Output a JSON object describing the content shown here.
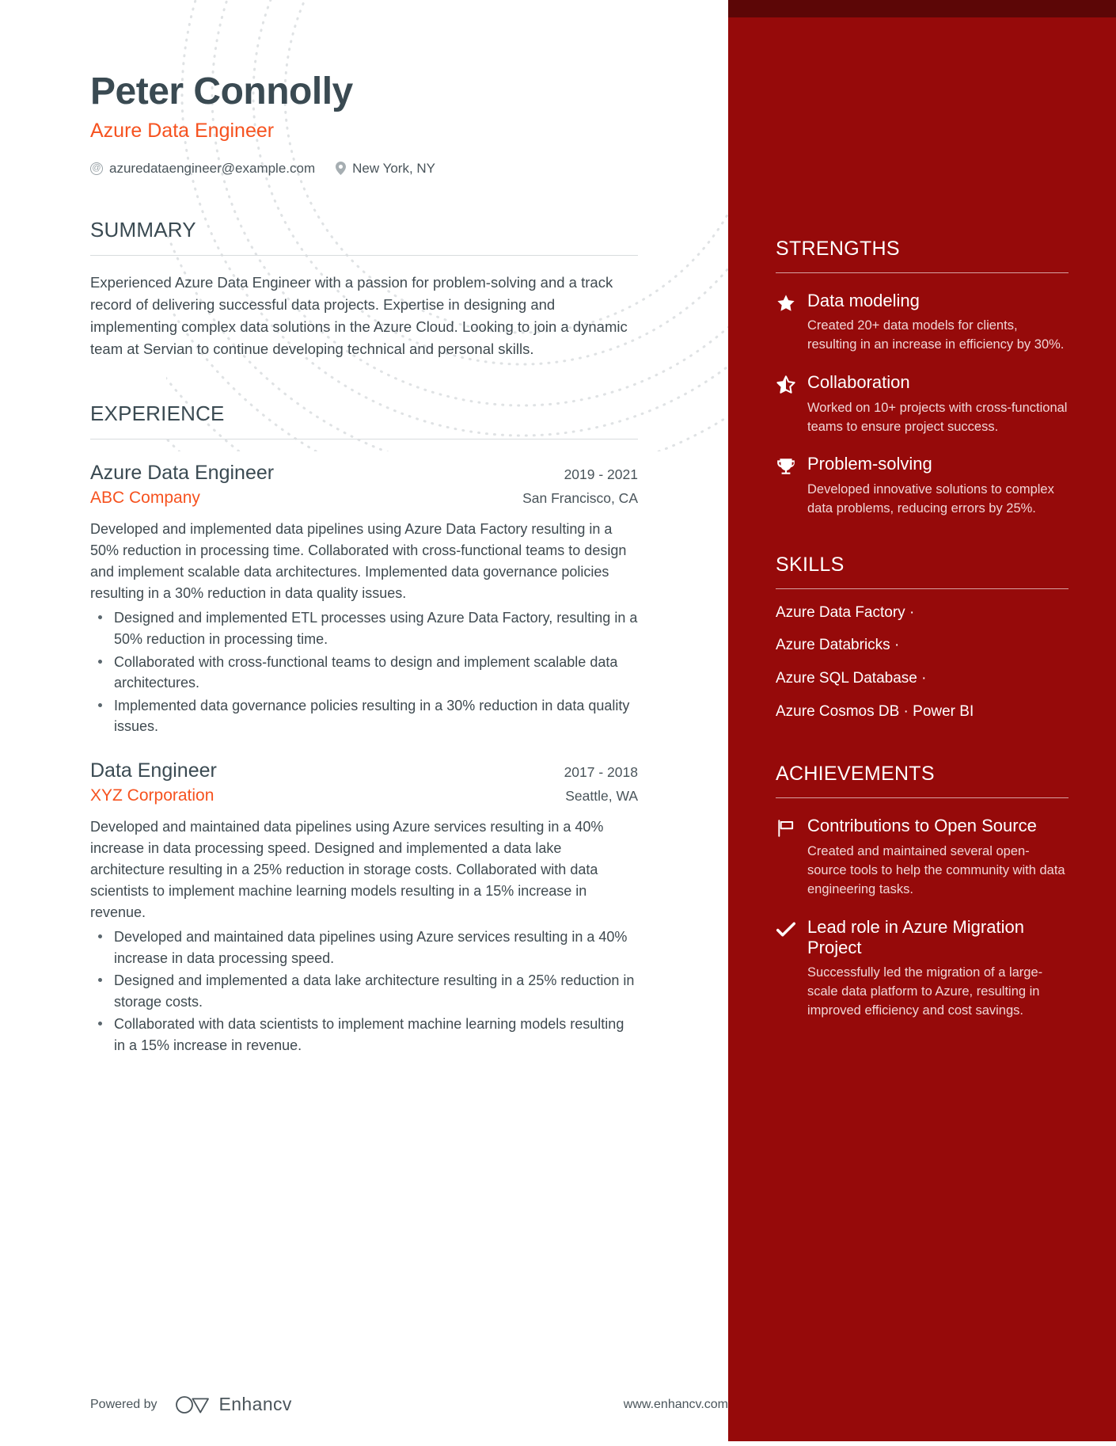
{
  "header": {
    "name": "Peter Connolly",
    "role": "Azure Data Engineer",
    "email": "azuredataengineer@example.com",
    "location": "New York, NY"
  },
  "colors": {
    "sidebar_red": "#960A0A",
    "sidebar_top_strip": "#5C0606",
    "accent_orange": "#F6521F",
    "heading_slate": "#3A4A52"
  },
  "summary": {
    "title": "SUMMARY",
    "text": "Experienced Azure Data Engineer with a passion for problem-solving and a track record of delivering successful data projects. Expertise in designing and implementing complex data solutions in the Azure Cloud. Looking to join a dynamic team at Servian to continue developing technical and personal skills."
  },
  "experience": {
    "title": "EXPERIENCE",
    "jobs": [
      {
        "title": "Azure Data Engineer",
        "dates": "2019 - 2021",
        "company": "ABC Company",
        "location": "San Francisco, CA",
        "description": "Developed and implemented data pipelines using Azure Data Factory resulting in a 50% reduction in processing time. Collaborated with cross-functional teams to design and implement scalable data architectures. Implemented data governance policies resulting in a 30% reduction in data quality issues.",
        "bullets": [
          "Designed and implemented ETL processes using Azure Data Factory, resulting in a 50% reduction in processing time.",
          "Collaborated with cross-functional teams to design and implement scalable data architectures.",
          "Implemented data governance policies resulting in a 30% reduction in data quality issues."
        ]
      },
      {
        "title": "Data Engineer",
        "dates": "2017 - 2018",
        "company": "XYZ Corporation",
        "location": "Seattle, WA",
        "description": "Developed and maintained data pipelines using Azure services resulting in a 40% increase in data processing speed. Designed and implemented a data lake architecture resulting in a 25% reduction in storage costs. Collaborated with data scientists to implement machine learning models resulting in a 15% increase in revenue.",
        "bullets": [
          "Developed and maintained data pipelines using Azure services resulting in a 40% increase in data processing speed.",
          "Designed and implemented a data lake architecture resulting in a 25% reduction in storage costs.",
          "Collaborated with data scientists to implement machine learning models resulting in a 15% increase in revenue."
        ]
      }
    ]
  },
  "strengths": {
    "title": "STRENGTHS",
    "items": [
      {
        "icon": "star-filled-icon",
        "name": "Data modeling",
        "description": "Created 20+ data models for clients, resulting in an increase in efficiency by 30%."
      },
      {
        "icon": "star-half-icon",
        "name": "Collaboration",
        "description": "Worked on 10+ projects with cross-functional teams to ensure project success."
      },
      {
        "icon": "trophy-icon",
        "name": "Problem-solving",
        "description": "Developed innovative solutions to complex data problems, reducing errors by 25%."
      }
    ]
  },
  "skills": {
    "title": "SKILLS",
    "lines": [
      "Azure Data Factory ·",
      "Azure Databricks ·",
      "Azure SQL Database ·",
      "Azure Cosmos DB · Power BI"
    ]
  },
  "achievements": {
    "title": "ACHIEVEMENTS",
    "items": [
      {
        "icon": "flag-icon",
        "name": "Contributions to Open Source",
        "description": "Created and maintained several open-source tools to help the community with data engineering tasks."
      },
      {
        "icon": "check-icon",
        "name": "Lead role in Azure Migration Project",
        "description": "Successfully led the migration of a large-scale data platform to Azure, resulting in improved efficiency and cost savings."
      }
    ]
  },
  "footer": {
    "powered_by": "Powered by",
    "brand": "Enhancv",
    "url": "www.enhancv.com"
  }
}
